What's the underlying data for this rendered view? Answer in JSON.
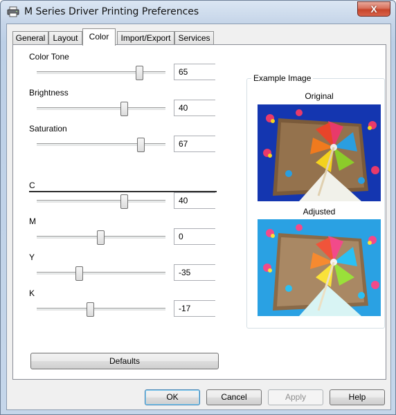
{
  "window": {
    "title": "M Series Driver Printing Preferences",
    "close_glyph": "X"
  },
  "tabs": [
    {
      "label": "General",
      "active": false
    },
    {
      "label": "Layout",
      "active": false
    },
    {
      "label": "Color",
      "active": true
    },
    {
      "label": "Import/Export",
      "active": false
    },
    {
      "label": "Services",
      "active": false
    }
  ],
  "sliders": {
    "color_tone": {
      "label": "Color Tone",
      "value": "65"
    },
    "brightness": {
      "label": "Brightness",
      "value": "40"
    },
    "saturation": {
      "label": "Saturation",
      "value": "67"
    },
    "c": {
      "label": "C",
      "value": "40"
    },
    "m": {
      "label": "M",
      "value": "0"
    },
    "y": {
      "label": "Y",
      "value": "-35"
    },
    "k": {
      "label": "K",
      "value": "-17"
    }
  },
  "defaults_label": "Defaults",
  "example": {
    "group_title": "Example Image",
    "original_caption": "Original",
    "adjusted_caption": "Adjusted"
  },
  "buttons": {
    "ok": "OK",
    "cancel": "Cancel",
    "apply": "Apply",
    "help": "Help"
  },
  "icons": {
    "window": "printer-icon",
    "close": "close-icon"
  },
  "colors": {
    "accent": "#3c7fb1",
    "close": "#c7452b",
    "panel": "#ffffff"
  }
}
